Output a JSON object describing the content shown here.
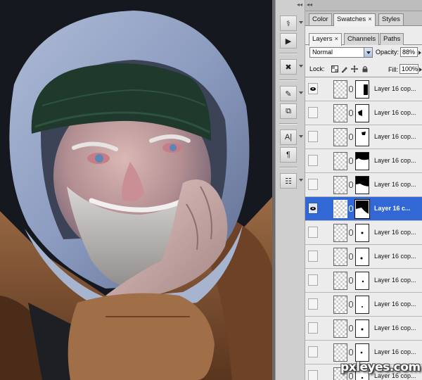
{
  "top_tabs": [
    {
      "label": "Color",
      "active": false
    },
    {
      "label": "Swatches",
      "active": true,
      "closable": true
    },
    {
      "label": "Styles",
      "active": false
    }
  ],
  "layer_tabs": [
    {
      "label": "Layers",
      "active": true,
      "closable": true
    },
    {
      "label": "Channels",
      "active": false
    },
    {
      "label": "Paths",
      "active": false
    }
  ],
  "close_glyph": "×",
  "collapse_glyph": "◂◂",
  "blend_mode": "Normal",
  "opacity_label": "Opacity:",
  "opacity_value": "88%",
  "lock_label": "Lock:",
  "fill_label": "Fill:",
  "fill_value": "100%",
  "tools": [
    {
      "icon": "brush-preset-icon",
      "glyph": "⚕"
    },
    {
      "icon": "play-action-icon",
      "glyph": "▶"
    },
    {
      "icon": "crossed-tools-icon",
      "glyph": "✖"
    },
    {
      "icon": "eyedropper-icon",
      "glyph": "✎"
    },
    {
      "icon": "clone-source-icon",
      "glyph": "⧉"
    },
    {
      "icon": "character-icon",
      "glyph": "A|"
    },
    {
      "icon": "paragraph-icon",
      "glyph": "¶"
    },
    {
      "icon": "notes-icon",
      "glyph": "☷"
    }
  ],
  "layers": [
    {
      "name": "Layer 16 cop...",
      "visible": true,
      "selected": false,
      "mask": "b"
    },
    {
      "name": "Layer 16 cop...",
      "visible": false,
      "selected": false,
      "mask": "c"
    },
    {
      "name": "Layer 16 cop...",
      "visible": false,
      "selected": false,
      "mask": "d"
    },
    {
      "name": "Layer 16 cop...",
      "visible": false,
      "selected": false,
      "mask": "e"
    },
    {
      "name": "Layer 16 cop...",
      "visible": false,
      "selected": false,
      "mask": "f"
    },
    {
      "name": "Layer 16 c...",
      "visible": true,
      "selected": true,
      "mask": "g"
    },
    {
      "name": "Layer 16 cop...",
      "visible": false,
      "selected": false,
      "mask": "h"
    },
    {
      "name": "Layer 16 cop...",
      "visible": false,
      "selected": false,
      "mask": "i"
    },
    {
      "name": "Layer 16 cop...",
      "visible": false,
      "selected": false,
      "mask": "j"
    },
    {
      "name": "Layer 16 cop...",
      "visible": false,
      "selected": false,
      "mask": "k"
    },
    {
      "name": "Layer 16 cop...",
      "visible": false,
      "selected": false,
      "mask": "l"
    },
    {
      "name": "Layer 16 cop...",
      "visible": false,
      "selected": false,
      "mask": "m"
    },
    {
      "name": "Layer 16 cop...",
      "visible": false,
      "selected": false,
      "mask": "n"
    }
  ],
  "watermark": "pxleyes.com",
  "colors": {
    "selection": "#3168d5",
    "panel_bg": "#ececec",
    "hood": "#8fa3c7",
    "jacket": "#8a5a36"
  }
}
